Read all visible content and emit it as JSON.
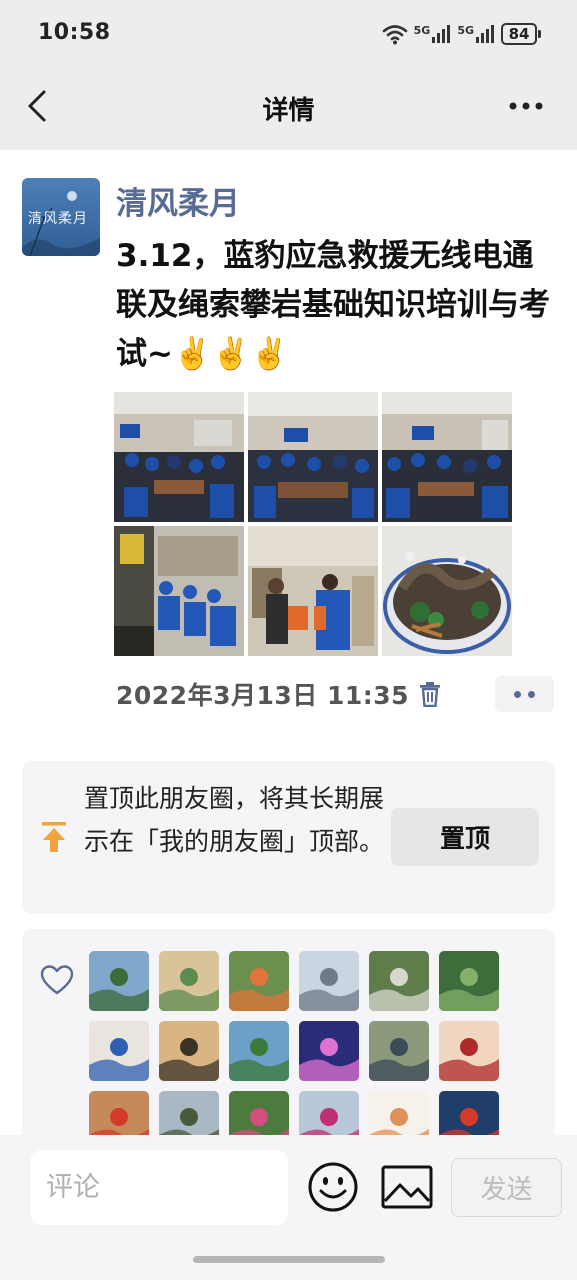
{
  "status_bar": {
    "time": "10:58",
    "signal_1": "5G",
    "signal_2": "5G",
    "battery": "84"
  },
  "nav": {
    "title": "详情",
    "back_icon": "chevron-left-icon",
    "more_icon": "more-horizontal-icon"
  },
  "post": {
    "author": "清风柔月",
    "avatar_text": "清风柔月",
    "text": "3.12，蓝豹应急救援无线电通联及绳索攀岩基础知识培训与考试~✌️✌️✌️",
    "photos": [
      {
        "kind": "meeting-room",
        "accent": "#1e4fa8"
      },
      {
        "kind": "meeting-room",
        "accent": "#1e4fa8"
      },
      {
        "kind": "meeting-room",
        "accent": "#1e4fa8"
      },
      {
        "kind": "storage-room",
        "accent": "#2458b8"
      },
      {
        "kind": "training",
        "accent": "#e06a2a"
      },
      {
        "kind": "bonsai",
        "accent": "#2f6e35"
      }
    ],
    "timestamp": "2022年3月13日 11:35"
  },
  "pin": {
    "text": "置顶此朋友圈，将其长期展示在「我的朋友圈」顶部。",
    "button_label": "置顶"
  },
  "likes": {
    "avatars": [
      {
        "bg": "#7ea7c9",
        "fg": "#3e6b3a"
      },
      {
        "bg": "#d9c49a",
        "fg": "#5c8c4f"
      },
      {
        "bg": "#6a8f4f",
        "fg": "#e0743a"
      },
      {
        "bg": "#c9d6e2",
        "fg": "#6f7a8a"
      },
      {
        "bg": "#5f7d4a",
        "fg": "#d7d7d0"
      },
      {
        "bg": "#3e6d3c",
        "fg": "#86b06a"
      },
      {
        "bg": "#e9e5de",
        "fg": "#2f5fb0"
      },
      {
        "bg": "#d9b583",
        "fg": "#3c3328"
      },
      {
        "bg": "#6ba0c9",
        "fg": "#3e7a3a"
      },
      {
        "bg": "#2a2c7a",
        "fg": "#e070d0"
      },
      {
        "bg": "#8a9a7a",
        "fg": "#3c4a5a"
      },
      {
        "bg": "#f0d6c0",
        "fg": "#b02a2a"
      },
      {
        "bg": "#c58a5a",
        "fg": "#d33a2a"
      },
      {
        "bg": "#a9b8c2",
        "fg": "#4a5a3a"
      },
      {
        "bg": "#4d7a3d",
        "fg": "#d05080"
      },
      {
        "bg": "#b8c8d8",
        "fg": "#c03070"
      },
      {
        "bg": "#f6f1ea",
        "fg": "#e0905a"
      },
      {
        "bg": "#1f3f6a",
        "fg": "#d43a2a"
      }
    ]
  },
  "composer": {
    "placeholder": "评论",
    "emoji_icon": "smiley-icon",
    "image_icon": "image-icon",
    "send_label": "发送"
  }
}
